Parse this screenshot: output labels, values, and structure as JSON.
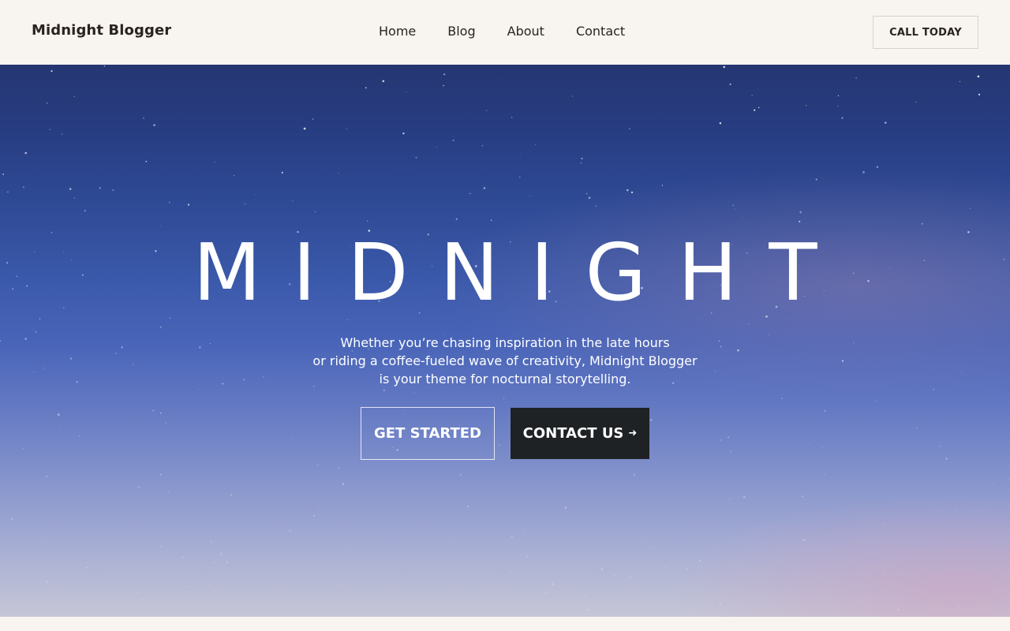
{
  "header": {
    "site_title": "Midnight Blogger",
    "nav": [
      "Home",
      "Blog",
      "About",
      "Contact"
    ],
    "cta_label": "CALL TODAY"
  },
  "hero": {
    "title": "MIDNIGHT",
    "description_lines": [
      "Whether you’re chasing inspiration in the late hours",
      "or riding a coffee-fueled wave of creativity, Midnight Blogger",
      "is your theme for nocturnal storytelling."
    ],
    "primary_button": "GET STARTED",
    "secondary_button": "CONTACT US",
    "secondary_button_icon": "arrow-right-icon"
  },
  "colors": {
    "background": "#f8f4ef",
    "text": "#2a2320",
    "dark_button": "#1f2224",
    "sky_top": "#253672",
    "sky_bottom": "#c6c6d6"
  }
}
